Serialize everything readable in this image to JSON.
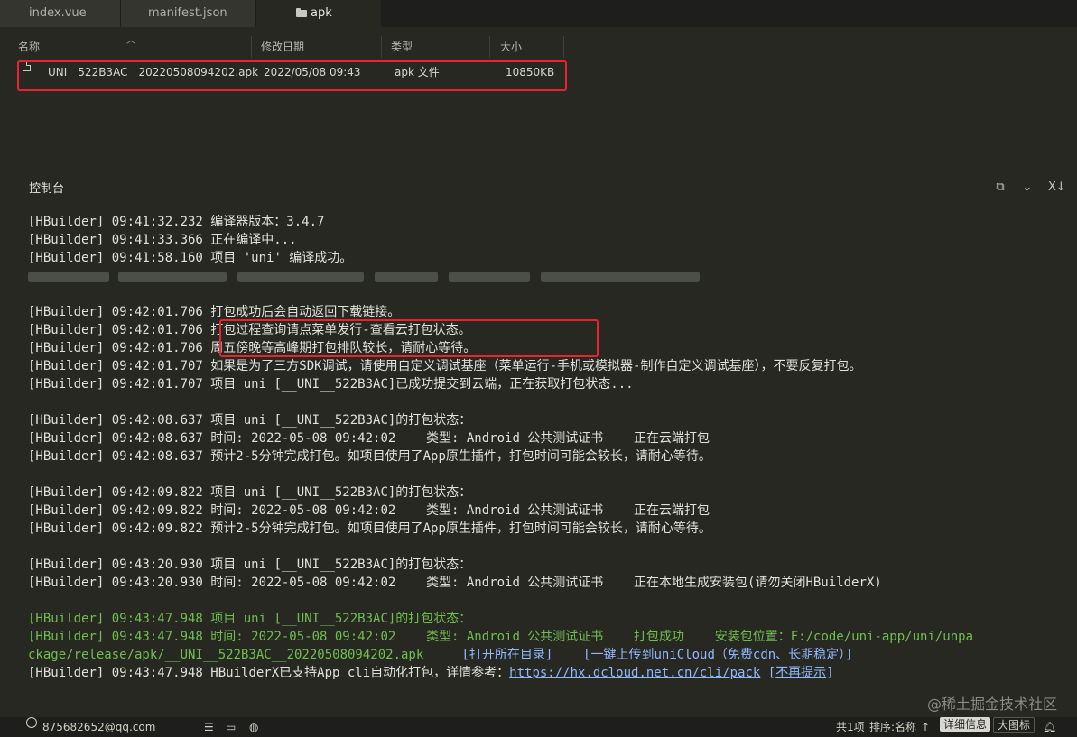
{
  "tabs": [
    {
      "label": "index.vue"
    },
    {
      "label": "manifest.json"
    },
    {
      "label": "apk"
    }
  ],
  "explorer": {
    "columns": {
      "name": "名称",
      "modified": "修改日期",
      "type": "类型",
      "size": "大小"
    },
    "files": [
      {
        "name": "__UNI__522B3AC__20220508094202.apk",
        "modified": "2022/05/08 09:43",
        "type": "apk 文件",
        "size": "10850KB"
      }
    ]
  },
  "console": {
    "tab_label": "控制台",
    "lines": [
      {
        "prefix": "[HBuilder] 09:41:32.232 ",
        "text": "编译器版本：3.4.7"
      },
      {
        "prefix": "[HBuilder] 09:41:33.366 ",
        "text": "正在编译中..."
      },
      {
        "prefix": "[HBuilder] 09:41:58.160 ",
        "text": "项目 'uni' 编译成功。"
      },
      {
        "prefix": "[HBuilder] 09:42:01.706 ",
        "text": "打包成功后会自动返回下载链接。"
      },
      {
        "prefix": "[HBuilder] 09:42:01.706 ",
        "text": "打包过程查询请点菜单发行-查看云打包状态。"
      },
      {
        "prefix": "[HBuilder] 09:42:01.706 ",
        "text": "周五傍晚等高峰期打包排队较长，请耐心等待。"
      },
      {
        "prefix": "[HBuilder] 09:42:01.707 ",
        "text": "如果是为了三方SDK调试，请使用自定义调试基座（菜单运行-手机或模拟器-制作自定义调试基座），不要反复打包。"
      },
      {
        "prefix": "[HBuilder] 09:42:01.707 ",
        "text": "项目 uni [__UNI__522B3AC]已成功提交到云端，正在获取打包状态..."
      },
      {
        "prefix": "[HBuilder] 09:42:08.637 ",
        "text": "项目 uni [__UNI__522B3AC]的打包状态："
      },
      {
        "prefix": "[HBuilder] 09:42:08.637 ",
        "text": "时间: 2022-05-08 09:42:02    类型: Android 公共测试证书    正在云端打包"
      },
      {
        "prefix": "[HBuilder] 09:42:08.637 ",
        "text": "预计2-5分钟完成打包。如项目使用了App原生插件，打包时间可能会较长，请耐心等待。"
      },
      {
        "prefix": "[HBuilder] 09:42:09.822 ",
        "text": "项目 uni [__UNI__522B3AC]的打包状态："
      },
      {
        "prefix": "[HBuilder] 09:42:09.822 ",
        "text": "时间: 2022-05-08 09:42:02    类型: Android 公共测试证书    正在云端打包"
      },
      {
        "prefix": "[HBuilder] 09:42:09.822 ",
        "text": "预计2-5分钟完成打包。如项目使用了App原生插件，打包时间可能会较长，请耐心等待。"
      },
      {
        "prefix": "[HBuilder] 09:43:20.930 ",
        "text": "项目 uni [__UNI__522B3AC]的打包状态："
      },
      {
        "prefix": "[HBuilder] 09:43:20.930 ",
        "text": "时间: 2022-05-08 09:42:02    类型: Android 公共测试证书    正在本地生成安装包(请勿关闭HBuilderX)"
      },
      {
        "prefix": "[HBuilder] 09:43:47.948 ",
        "text": "项目 uni [__UNI__522B3AC]的打包状态："
      },
      {
        "prefix": "[HBuilder] 09:43:47.948 ",
        "text": "时间: 2022-05-08 09:42:02    类型: Android 公共测试证书    打包成功    安装包位置：F:/code/uni-app/uni/unpa"
      },
      {
        "prefix": "",
        "text": "ckage/release/apk/__UNI__522B3AC__20220508094202.apk"
      },
      {
        "open_dir_link": "[打开所在目录]",
        "upload_link": "[一键上传到uniCloud（免费cdn、长期稳定）]"
      },
      {
        "prefix": "[HBuilder] 09:43:47.948 ",
        "text": "HBuilderX已支持App cli自动化打包，详情参考：",
        "url": "https://hx.dcloud.net.cn/cli/pack",
        "dismiss_open": "[",
        "dismiss": "不再提示",
        "dismiss_close": "]"
      }
    ]
  },
  "status_bar": {
    "account": "875682652@qq.com",
    "count": "共1项",
    "sort": "排序:名称",
    "btn_detail": "详细信息",
    "btn_large_icon": "大图标"
  },
  "watermark": "@稀土掘金技术社区",
  "colors": {
    "highlight_box": "#e8242c",
    "success_green": "#6fbf4f",
    "link_blue": "#8fb8ff"
  }
}
